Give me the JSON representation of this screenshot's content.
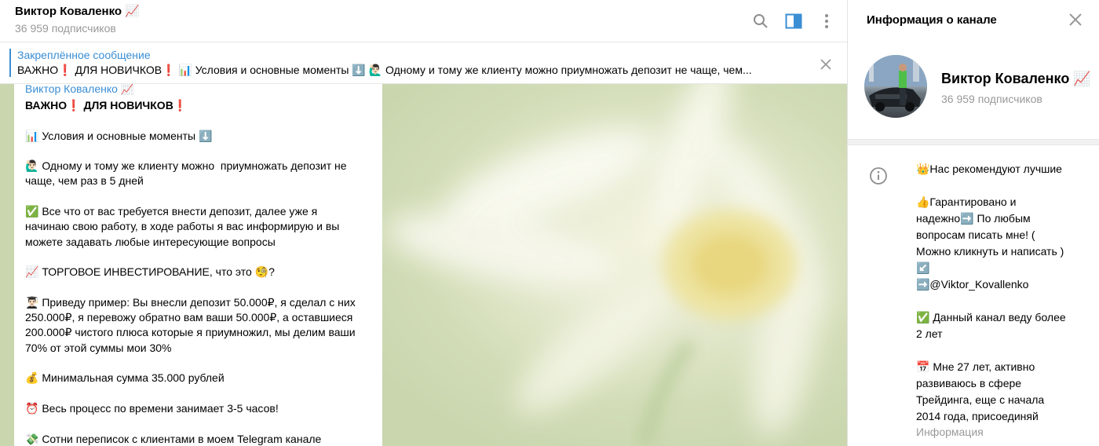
{
  "chat": {
    "title": "Виктор Коваленко 📈",
    "subscribers": "36 959 подписчиков",
    "icons": [
      "search-icon",
      "sidebar-toggle-icon",
      "more-vertical-icon"
    ]
  },
  "pinned": {
    "title": "Закреплённое сообщение",
    "text": "ВАЖНО❗ ДЛЯ НОВИЧКОВ❗  📊 Условия и основные моменты ⬇️  🙋🏻‍♂️ Одному и тому же клиенту можно  приумножать депозит не чаще, чем..."
  },
  "message": {
    "author": "Виктор Коваленко 📈",
    "lines": [
      "ВАЖНО❗ ДЛЯ НОВИЧКОВ❗",
      "",
      "📊 Условия и основные моменты ⬇️",
      "",
      "🙋🏻‍♂️ Одному и тому же клиенту можно  приумножать депозит не",
      "чаще, чем раз в 5 дней",
      "",
      "✅ Все что от вас требуется внести депозит, далее уже я",
      "начинаю свою работу, в ходе работы я вас информирую и вы",
      "можете задавать любые интересующие вопросы",
      "",
      "📈 ТОРГОВОЕ ИНВЕСТИРОВАНИЕ, что это 🧐?",
      "",
      "👨🏻‍🎓 Приведу пример: Вы внесли депозит 50.000₽, я сделал с них",
      "250.000₽, я перевожу обратно вам ваши 50.000₽, а оставшиеся",
      "200.000₽ чистого плюса которые я приумножил, мы делим ваши",
      "70% от этой суммы мои 30%",
      "",
      "💰 Минимальная сумма 35.000 рублей",
      "",
      "⏰ Весь процесс по времени занимает 3-5 часов!",
      "",
      "💸 Сотни переписок с клиентами в моем Telegram канале"
    ]
  },
  "panel": {
    "title": "Информация о канале",
    "name": "Виктор Коваленко 📈",
    "subscribers": "36 959 подписчиков",
    "description_lines": [
      "👑Нас рекомендуют лучшие",
      "",
      "👍Гарантировано и",
      "надежно➡️ По любым",
      "вопросам писать мне! (",
      "Можно кликнуть и написать )",
      "↙️",
      "➡️@Viktor_Kovallenko",
      "",
      "✅ Данный канал веду более",
      "2 лет",
      "",
      "📅 Мне 27 лет, активно",
      "развиваюсь в сфере",
      "Трейдинга, еще с начала",
      "2014 года, присоединяй"
    ],
    "description_label": "Информация"
  },
  "colors": {
    "accent": "#3a8ed4",
    "muted": "#999999",
    "divider": "#f1f1f1"
  }
}
